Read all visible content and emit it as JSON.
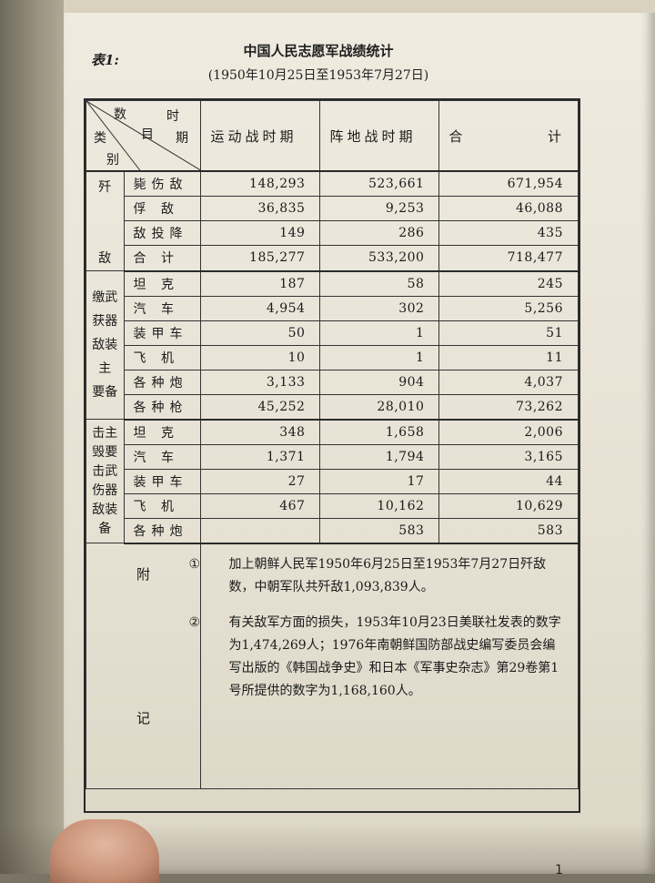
{
  "table_label": "表1:",
  "title": "中国人民志愿军战绩统计",
  "subtitle": "(1950年10月25日至1953年7月27日)",
  "header": {
    "corner_top": [
      "数",
      "时"
    ],
    "corner_mid": [
      "类",
      "目",
      "期"
    ],
    "corner_bottom": "别",
    "columns": [
      "运动战时期",
      "阵地战时期",
      "合",
      "计"
    ]
  },
  "groups": [
    {
      "category_top": "歼",
      "category_bottom": "敌",
      "rows": [
        {
          "item": "毙伤敌",
          "values": [
            "148,293",
            "523,661",
            "671,954"
          ]
        },
        {
          "item": "俘  敌",
          "values": [
            "36,835",
            "9,253",
            "46,088"
          ]
        },
        {
          "item": "敌投降",
          "values": [
            "149",
            "286",
            "435"
          ]
        },
        {
          "item": "合  计",
          "values": [
            "185,277",
            "533,200",
            "718,477"
          ]
        }
      ]
    },
    {
      "category_lines": [
        "缴武",
        "获器",
        "敌装",
        "主",
        "要备"
      ],
      "rows": [
        {
          "item": "坦  克",
          "values": [
            "187",
            "58",
            "245"
          ]
        },
        {
          "item": "汽  车",
          "values": [
            "4,954",
            "302",
            "5,256"
          ]
        },
        {
          "item": "装甲车",
          "values": [
            "50",
            "1",
            "51"
          ]
        },
        {
          "item": "飞  机",
          "values": [
            "10",
            "1",
            "11"
          ]
        },
        {
          "item": "各种炮",
          "values": [
            "3,133",
            "904",
            "4,037"
          ]
        },
        {
          "item": "各种枪",
          "values": [
            "45,252",
            "28,010",
            "73,262"
          ]
        }
      ]
    },
    {
      "category_lines": [
        "击主",
        "毁要",
        "击武",
        "伤器",
        "敌装",
        "备"
      ],
      "rows": [
        {
          "item": "坦  克",
          "values": [
            "348",
            "1,658",
            "2,006"
          ]
        },
        {
          "item": "汽  车",
          "values": [
            "1,371",
            "1,794",
            "3,165"
          ]
        },
        {
          "item": "装甲车",
          "values": [
            "27",
            "17",
            "44"
          ]
        },
        {
          "item": "飞  机",
          "values": [
            "467",
            "10,162",
            "10,629"
          ]
        },
        {
          "item": "各种炮",
          "values": [
            "",
            "583",
            "583"
          ]
        }
      ]
    }
  ],
  "notes_label": [
    "附",
    "记"
  ],
  "notes": [
    {
      "marker": "①",
      "text": "加上朝鲜人民军1950年6月25日至1953年7月27日歼敌数，中朝军队共歼敌1,093,839人。"
    },
    {
      "marker": "②",
      "text": "有关敌军方面的损失，1953年10月23日美联社发表的数字为1,474,269人；1976年南朝鲜国防部战史编写委员会编写出版的《韩国战争史》和日本《军事史杂志》第29卷第1号所提供的数字为1,168,160人。"
    }
  ],
  "page_number": "1"
}
